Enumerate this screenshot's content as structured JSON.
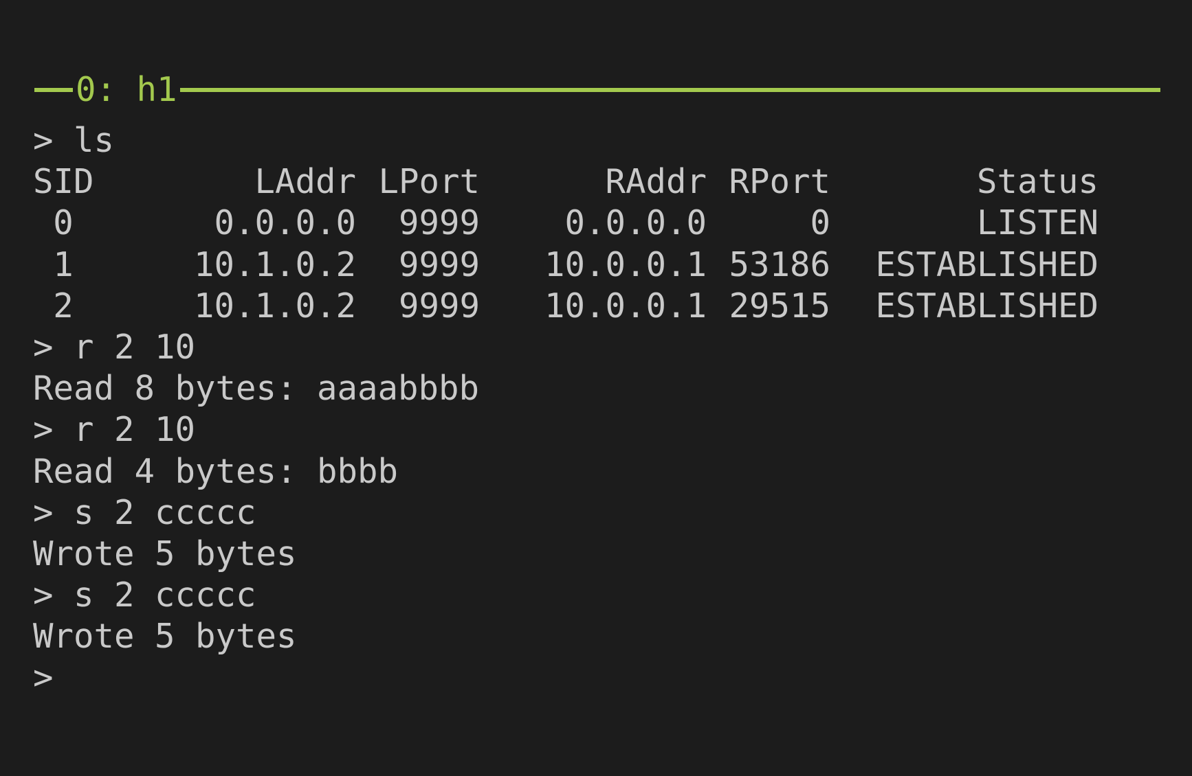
{
  "window": {
    "title": "0: h1",
    "accent_color": "#a3c94e",
    "background_color": "#1c1c1c",
    "text_color": "#c9c9c9"
  },
  "session": {
    "ls_command": "> ls",
    "table": {
      "headers": {
        "sid": "SID",
        "laddr": "LAddr",
        "lport": "LPort",
        "raddr": "RAddr",
        "rport": "RPort",
        "status": "Status"
      },
      "rows": [
        {
          "sid": "0",
          "laddr": "0.0.0.0",
          "lport": "9999",
          "raddr": "0.0.0.0",
          "rport": "0",
          "status": "LISTEN"
        },
        {
          "sid": "1",
          "laddr": "10.1.0.2",
          "lport": "9999",
          "raddr": "10.0.0.1",
          "rport": "53186",
          "status": "ESTABLISHED"
        },
        {
          "sid": "2",
          "laddr": "10.1.0.2",
          "lport": "9999",
          "raddr": "10.0.0.1",
          "rport": "29515",
          "status": "ESTABLISHED"
        }
      ]
    },
    "lines_after_table": [
      {
        "kind": "command",
        "text": "> r 2 10"
      },
      {
        "kind": "output",
        "text": "Read 8 bytes: aaaabbbb"
      },
      {
        "kind": "command",
        "text": "> r 2 10"
      },
      {
        "kind": "output",
        "text": "Read 4 bytes: bbbb"
      },
      {
        "kind": "command",
        "text": "> s 2 ccccc"
      },
      {
        "kind": "output",
        "text": "Wrote 5 bytes"
      },
      {
        "kind": "command",
        "text": "> s 2 ccccc"
      },
      {
        "kind": "output",
        "text": "Wrote 5 bytes"
      }
    ],
    "prompt": ">"
  }
}
